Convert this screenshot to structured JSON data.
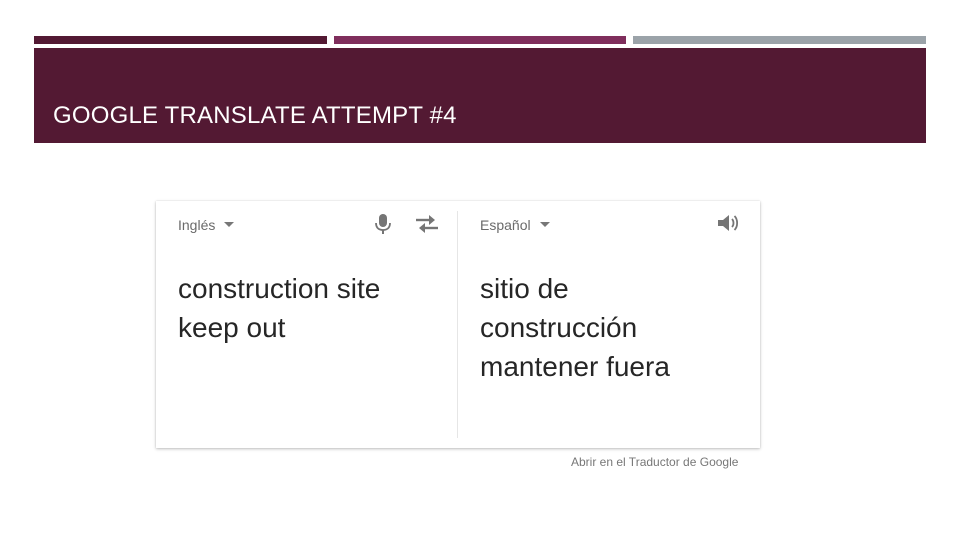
{
  "colors": {
    "bar1": "#531933",
    "bar2": "#7f2e5c",
    "bar3": "#9ba3a9",
    "title_band": "#531933"
  },
  "slide": {
    "title": "GOOGLE TRANSLATE ATTEMPT #4"
  },
  "translator": {
    "source_language": "Inglés",
    "target_language": "Español",
    "source_lines": [
      "construction site",
      "keep out"
    ],
    "target_lines": [
      "sitio de",
      "construcción",
      "mantener fuera"
    ],
    "icons": {
      "mic": "microphone-icon",
      "swap": "swap-languages-icon",
      "speaker": "speaker-icon"
    },
    "open_link": "Abrir en el Traductor de Google"
  }
}
